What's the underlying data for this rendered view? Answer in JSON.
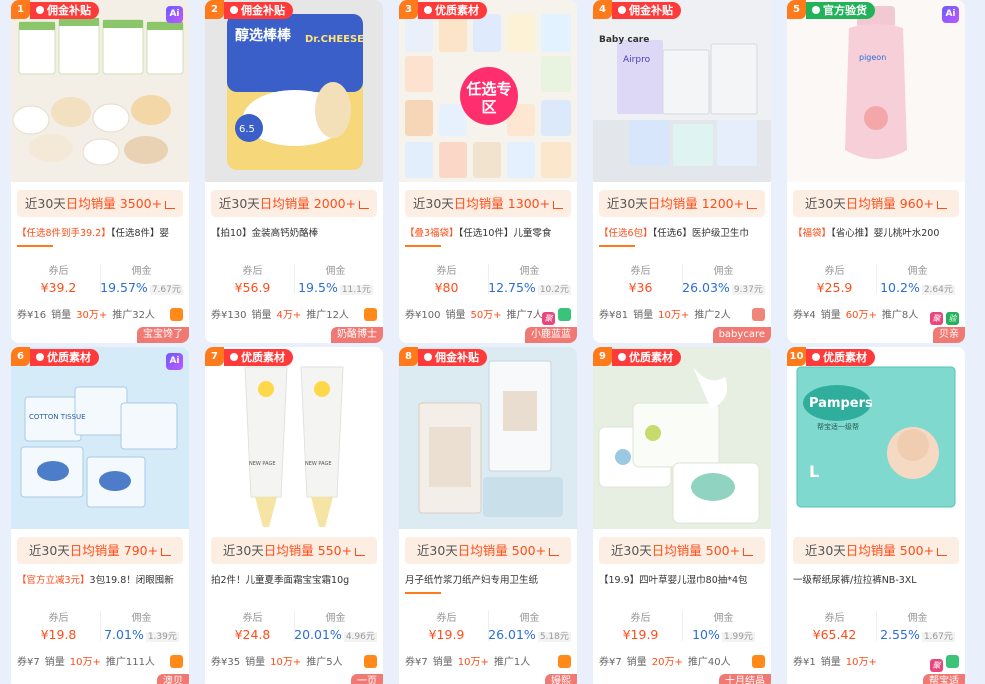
{
  "cards": [
    {
      "rank": "1",
      "tag": "佣金补贴",
      "brand": "宝宝馋了",
      "sales_prefix": "近30天",
      "sales_mid": "日均销量",
      "sales_val": "3500+",
      "title_red": "【任选8件到手39.2】",
      "title_text": "【任选8件】婴",
      "coupon_lbl": "券后",
      "comm_lbl": "佣金",
      "price": "¥39.2",
      "rate": "19.57%",
      "comm": "7.67元",
      "q": "券¥16",
      "sold": "销量",
      "sold_val": "30万+",
      "promo": "推广32人"
    },
    {
      "rank": "2",
      "tag": "佣金补贴",
      "brand": "奶酪博士",
      "sales_prefix": "近30天",
      "sales_mid": "日均销量",
      "sales_val": "2000+",
      "title_red": "",
      "title_text": "【拍10】金装高钙奶酪棒",
      "coupon_lbl": "券后",
      "comm_lbl": "佣金",
      "price": "¥56.9",
      "rate": "19.5%",
      "comm": "11.1元",
      "q": "券¥130",
      "sold": "销量",
      "sold_val": "4万+",
      "promo": "推广12人"
    },
    {
      "rank": "3",
      "tag": "优质素材",
      "brand": "小鹿蓝蓝",
      "sales_prefix": "近30天",
      "sales_mid": "日均销量",
      "sales_val": "1300+",
      "title_red": "【叠3福袋】",
      "title_text": "【任选10件】儿童零食",
      "coupon_lbl": "券后",
      "comm_lbl": "佣金",
      "price": "¥80",
      "rate": "12.75%",
      "comm": "10.2元",
      "q": "券¥100",
      "sold": "销量",
      "sold_val": "50万+",
      "promo": "推广7人"
    },
    {
      "rank": "4",
      "tag": "佣金补贴",
      "brand": "babycare",
      "sales_prefix": "近30天",
      "sales_mid": "日均销量",
      "sales_val": "1200+",
      "title_red": "【任选6包】",
      "title_text": "【任选6】医护级卫生巾",
      "coupon_lbl": "券后",
      "comm_lbl": "佣金",
      "price": "¥36",
      "rate": "26.03%",
      "comm": "9.37元",
      "q": "券¥81",
      "sold": "销量",
      "sold_val": "10万+",
      "promo": "推广2人"
    },
    {
      "rank": "5",
      "tag": "官方验货",
      "brand": "贝亲",
      "sales_prefix": "近30天",
      "sales_mid": "日均销量",
      "sales_val": "960+",
      "title_red": "【福袋】",
      "title_text": "【省心推】婴儿桃叶水200",
      "coupon_lbl": "券后",
      "comm_lbl": "佣金",
      "price": "¥25.9",
      "rate": "10.2%",
      "comm": "2.64元",
      "q": "券¥4",
      "sold": "销量",
      "sold_val": "60万+",
      "promo": "推广8人"
    },
    {
      "rank": "6",
      "tag": "优质素材",
      "brand": "澳贝",
      "sales_prefix": "近30天",
      "sales_mid": "日均销量",
      "sales_val": "790+",
      "title_red": "【官方立减3元】",
      "title_text": "3包19.8！闭眼囤新",
      "coupon_lbl": "券后",
      "comm_lbl": "佣金",
      "price": "¥19.8",
      "rate": "7.01%",
      "comm": "1.39元",
      "q": "券¥7",
      "sold": "销量",
      "sold_val": "10万+",
      "promo": "推广111人"
    },
    {
      "rank": "7",
      "tag": "优质素材",
      "brand": "一页",
      "sales_prefix": "近30天",
      "sales_mid": "日均销量",
      "sales_val": "550+",
      "title_red": "",
      "title_text": "拍2件！儿童夏季面霜宝宝霜10g",
      "coupon_lbl": "券后",
      "comm_lbl": "佣金",
      "price": "¥24.8",
      "rate": "20.01%",
      "comm": "4.96元",
      "q": "券¥35",
      "sold": "销量",
      "sold_val": "10万+",
      "promo": "推广5人"
    },
    {
      "rank": "8",
      "tag": "佣金补贴",
      "brand": "嫚熙",
      "sales_prefix": "近30天",
      "sales_mid": "日均销量",
      "sales_val": "500+",
      "title_red": "",
      "title_text": "月子纸竹浆刀纸产妇专用卫生纸",
      "coupon_lbl": "券后",
      "comm_lbl": "佣金",
      "price": "¥19.9",
      "rate": "26.01%",
      "comm": "5.18元",
      "q": "券¥7",
      "sold": "销量",
      "sold_val": "10万+",
      "promo": "推广1人"
    },
    {
      "rank": "9",
      "tag": "优质素材",
      "brand": "十月结晶",
      "sales_prefix": "近30天",
      "sales_mid": "日均销量",
      "sales_val": "500+",
      "title_red": "",
      "title_text": "【19.9】四叶草婴儿湿巾80抽*4包",
      "coupon_lbl": "券后",
      "comm_lbl": "佣金",
      "price": "¥19.9",
      "rate": "10%",
      "comm": "1.99元",
      "q": "券¥7",
      "sold": "销量",
      "sold_val": "20万+",
      "promo": "推广40人"
    },
    {
      "rank": "10",
      "tag": "优质素材",
      "brand": "帮宝适",
      "sales_prefix": "近30天",
      "sales_mid": "日均销量",
      "sales_val": "500+",
      "title_red": "",
      "title_text": "一级帮纸尿裤/拉拉裤NB-3XL",
      "coupon_lbl": "券后",
      "comm_lbl": "佣金",
      "price": "¥65.42",
      "rate": "2.55%",
      "comm": "1.67元",
      "q": "券¥1",
      "sold": "销量",
      "sold_val": "10万+",
      "promo": ""
    }
  ],
  "ai_label": "Ai",
  "img_text": {
    "c2_main": "醇选棒棒",
    "c2_sub": "Dr.CHEESE",
    "c2_pct": "6.5",
    "c3_bubble": "任选专区",
    "c4_logo": "Baby care",
    "c4_pack": "Airpro",
    "c5_label": "pigeon",
    "c6_pack": "COTTON TISSUE",
    "c7_brand": "NEW PAGE",
    "c10_brand": "Pampers",
    "c10_sub": "帮宝适一级帮",
    "c10_size": "L"
  },
  "badge_labels": {
    "mi": "聚",
    "ban": "验"
  },
  "colors": {
    "accent": "#ff4d19",
    "blue": "#2b6fd6",
    "tag_red": "#ff3a3a",
    "tag_green": "#22b35a",
    "rank": "#ff7a1a"
  }
}
